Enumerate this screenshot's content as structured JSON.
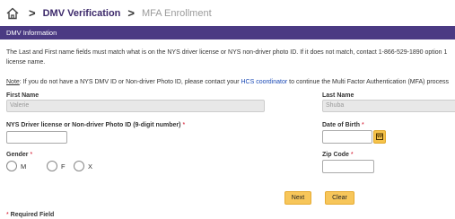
{
  "breadcrumb": {
    "current": "DMV Verification",
    "next": "MFA Enrollment"
  },
  "panel": {
    "title": "DMV Information"
  },
  "info": {
    "line1": "The Last and First name fields must match what is on the NYS driver license or NYS non-driver photo ID. If it does not match, contact 1-866-529-1890 option 1",
    "line2": "license name.",
    "note_label": "Note",
    "note_text_before": ": If you do not have a NYS DMV ID or Non-driver Photo ID, please contact your ",
    "note_link": "HCS coordinator",
    "note_text_after": " to continue the Multi Factor Authentication (MFA) process"
  },
  "form": {
    "first_name": {
      "label": "First Name",
      "value": "Valerie"
    },
    "last_name": {
      "label": "Last Name",
      "value": "Shuba"
    },
    "license": {
      "label": "NYS Driver license or Non-driver Photo ID (9-digit number)",
      "required_mark": "*",
      "value": ""
    },
    "dob": {
      "label": "Date of Birth",
      "required_mark": "*",
      "value": ""
    },
    "gender": {
      "label": "Gender",
      "required_mark": "*",
      "options": [
        "M",
        "F",
        "X"
      ]
    },
    "zip": {
      "label": "Zip Code",
      "required_mark": "*",
      "value": ""
    }
  },
  "buttons": {
    "next": "Next",
    "clear": "Clear"
  },
  "footer": {
    "required_mark": "*",
    "required_text": " Required Field"
  },
  "colors": {
    "header_bg": "#4b3a83",
    "button_bg": "#f7c65a",
    "required": "#d0021b",
    "link": "#1a49b5"
  }
}
